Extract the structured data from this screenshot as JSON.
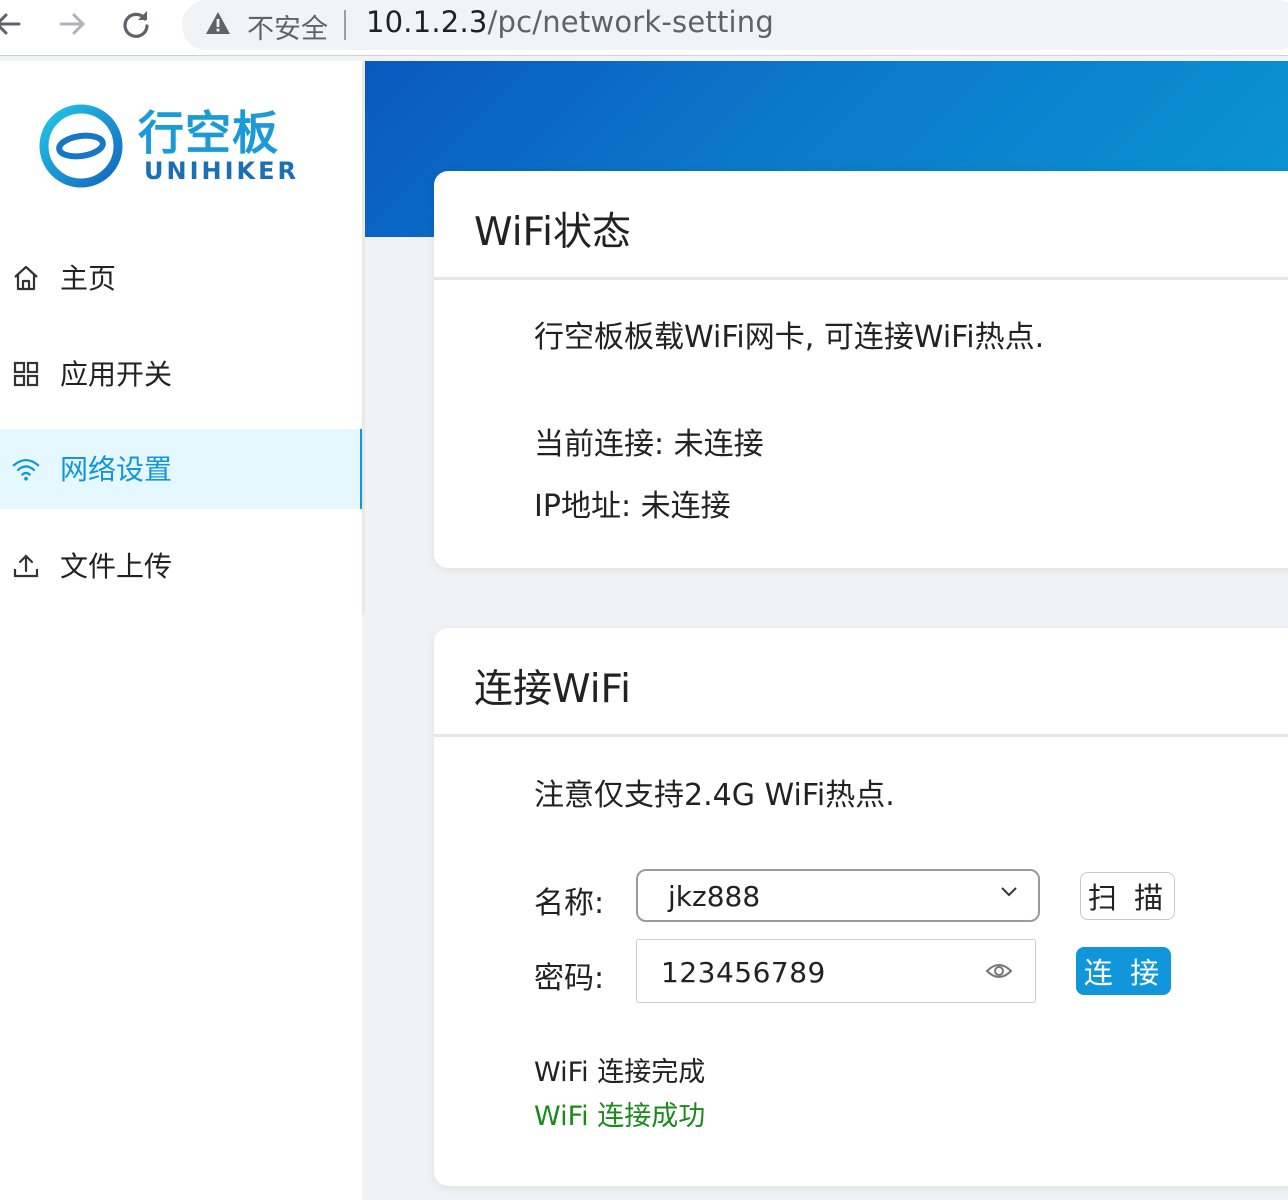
{
  "browser": {
    "back_icon": "arrow-left-icon",
    "forward_icon": "arrow-right-icon",
    "reload_icon": "reload-icon",
    "security_label": "不安全",
    "url_host": "10.1.2.3",
    "url_path": "/pc/network-setting"
  },
  "sidebar": {
    "logo_cn": "行空板",
    "logo_en": "UNIHIKER",
    "items": [
      {
        "label": "主页",
        "icon": "home-icon"
      },
      {
        "label": "应用开关",
        "icon": "grid-icon"
      },
      {
        "label": "网络设置",
        "icon": "wifi-icon",
        "active": true
      },
      {
        "label": "文件上传",
        "icon": "upload-icon"
      }
    ]
  },
  "wifi_status": {
    "title": "WiFi状态",
    "description": "行空板板载WiFi网卡, 可连接WiFi热点.",
    "current_connection": "当前连接: 未连接",
    "ip_address": "IP地址: 未连接"
  },
  "connect_wifi": {
    "title": "连接WiFi",
    "note": "注意仅支持2.4G WiFi热点.",
    "name_label": "名称:",
    "ssid_value": "jkz888",
    "scan_label": "扫 描",
    "password_label": "密码:",
    "password_value": "123456789",
    "connect_label": "连 接",
    "status_1": "WiFi 连接完成",
    "status_2": "WiFi 连接成功"
  },
  "colors": {
    "accent": "#1296db",
    "success": "#1a8a1a",
    "active_bg": "#e6f8ff"
  }
}
